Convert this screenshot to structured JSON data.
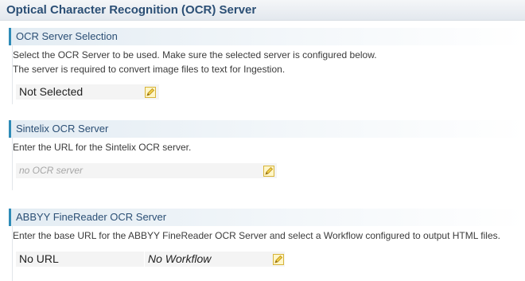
{
  "header": {
    "title": "Optical Character Recognition (OCR) Server"
  },
  "sections": [
    {
      "title": "OCR Server Selection",
      "description": [
        "Select the OCR Server to be used. Make sure the selected server is configured below.",
        "The server is required to convert image files to text for Ingestion."
      ],
      "fields": [
        {
          "value": "Not Selected"
        }
      ]
    },
    {
      "title": "Sintelix OCR Server",
      "description": [
        "Enter the URL for the Sintelix OCR server."
      ],
      "fields": [
        {
          "placeholder": "no OCR server"
        }
      ]
    },
    {
      "title": "ABBYY FineReader OCR Server",
      "description": [
        "Enter the base URL for the ABBYY FineReader OCR Server and select a Workflow configured to output HTML files."
      ],
      "fields": [
        {
          "value": "No URL"
        },
        {
          "value": "No Workflow"
        }
      ]
    }
  ],
  "icons": {
    "edit": "pencil-edit-icon"
  },
  "colors": {
    "header_text": "#2b4f75",
    "section_accent": "#2e8bb7",
    "icon_fill": "#f2d24a"
  }
}
